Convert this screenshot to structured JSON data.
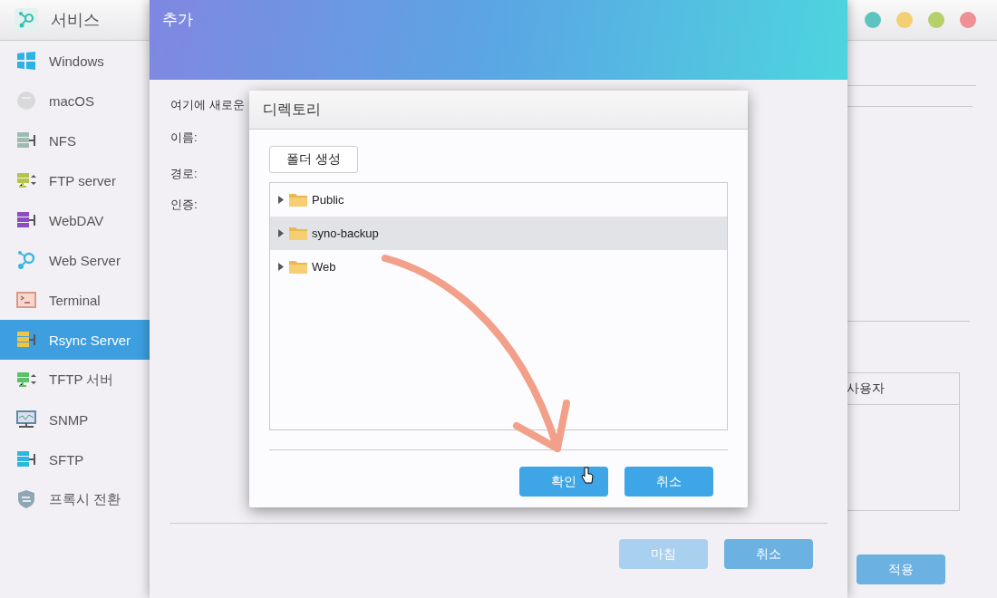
{
  "main_window": {
    "title": "서비스",
    "window_controls": [
      {
        "color": "#5cc3c0"
      },
      {
        "color": "#f2cf72"
      },
      {
        "color": "#b5cf6b"
      },
      {
        "color": "#ef8f96"
      }
    ],
    "sidebar": {
      "items": [
        {
          "label": "Windows",
          "kind": "windows",
          "color": "#2bb3e6",
          "selected": false
        },
        {
          "label": "macOS",
          "kind": "macos",
          "color": "#d9d9d9",
          "selected": false
        },
        {
          "label": "NFS",
          "kind": "server",
          "color": "#9fbcb3",
          "selected": false
        },
        {
          "label": "FTP server",
          "kind": "transfer",
          "color": "#b6c44a",
          "selected": false
        },
        {
          "label": "WebDAV",
          "kind": "server",
          "color": "#8b4fbf",
          "selected": false
        },
        {
          "label": "Web Server",
          "kind": "web",
          "color": "#3cb6df",
          "selected": false
        },
        {
          "label": "Terminal",
          "kind": "terminal",
          "color": "#d99a8a",
          "selected": false
        },
        {
          "label": "Rsync Server",
          "kind": "server",
          "color": "#f1c53f",
          "selected": true
        },
        {
          "label": "TFTP 서버",
          "kind": "transfer",
          "color": "#5cbf6a",
          "selected": false
        },
        {
          "label": "SNMP",
          "kind": "monitor",
          "color": "#5d8aa6",
          "selected": false
        },
        {
          "label": "SFTP",
          "kind": "server",
          "color": "#2cb6e0",
          "selected": false
        },
        {
          "label": "프록시 전환",
          "kind": "shield",
          "color": "#8fa7b4",
          "selected": false
        }
      ]
    },
    "table": {
      "column_header": "사용자"
    },
    "apply_button": "적용"
  },
  "add_dialog": {
    "title": "추가",
    "intro": "여기에 새로운",
    "fields": [
      {
        "label": "이름:"
      },
      {
        "label": "경로:"
      },
      {
        "label": "인증:"
      }
    ],
    "buttons": [
      {
        "label": "마침",
        "disabled": true
      },
      {
        "label": "취소",
        "disabled": false
      }
    ]
  },
  "directory_dialog": {
    "title": "디렉토리",
    "create_folder_button": "폴더 생성",
    "folders": [
      {
        "name": "Public",
        "selected": false
      },
      {
        "name": "syno-backup",
        "selected": true
      },
      {
        "name": "Web",
        "selected": false
      }
    ],
    "buttons": [
      {
        "label": "확인"
      },
      {
        "label": "취소"
      }
    ]
  }
}
